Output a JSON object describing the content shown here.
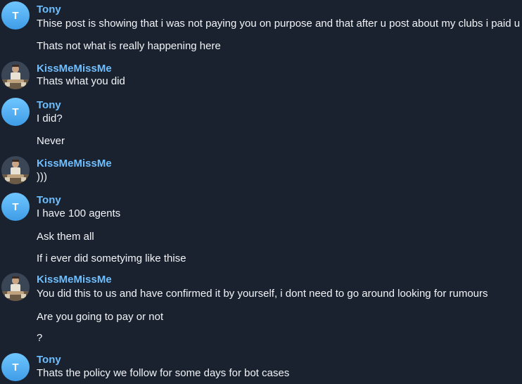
{
  "colors": {
    "background": "#1a2230",
    "tony_name": "#6fbfff",
    "kiss_name": "#6fbfff",
    "text": "#f2f4f7"
  },
  "messages": [
    {
      "sender": "Tony",
      "avatar_letter": "T",
      "lines": [
        "Thise post is showing that i was not paying you on purpose and that after u post about my clubs i paid u",
        "Thats not what is really happening here"
      ]
    },
    {
      "sender": "KissMeMissMe",
      "avatar_icon": "user-photo-icon",
      "lines": [
        "Thats what you did"
      ]
    },
    {
      "sender": "Tony",
      "avatar_letter": "T",
      "lines": [
        "I did?",
        "Never"
      ]
    },
    {
      "sender": "KissMeMissMe",
      "avatar_icon": "user-photo-icon",
      "lines": [
        ")))"
      ]
    },
    {
      "sender": "Tony",
      "avatar_letter": "T",
      "lines": [
        "I have 100 agents",
        "Ask them all",
        "If i ever did sometyimg like thise"
      ]
    },
    {
      "sender": "KissMeMissMe",
      "avatar_icon": "user-photo-icon",
      "lines": [
        "You did this to us and have confirmed it by yourself, i dont need to go around looking for rumours",
        "Are you going to pay or not",
        "?"
      ]
    },
    {
      "sender": "Tony",
      "avatar_letter": "T",
      "lines": [
        "Thats the policy we follow for some days for bot cases"
      ]
    }
  ]
}
